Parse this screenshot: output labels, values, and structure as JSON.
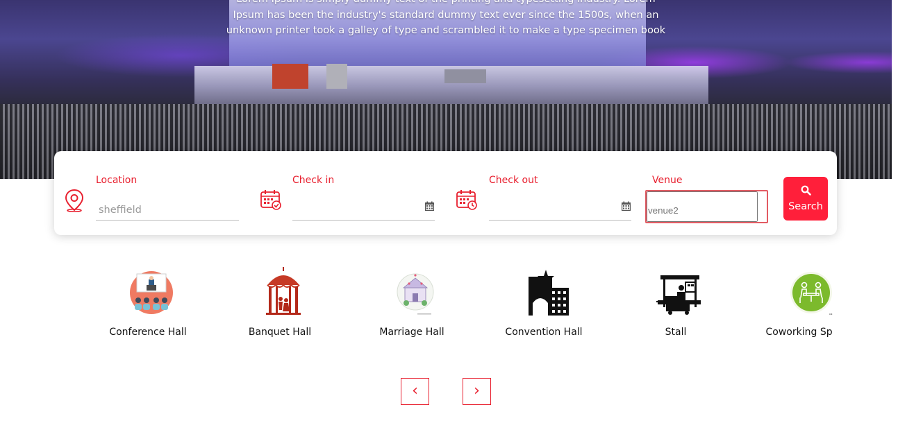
{
  "hero": {
    "text": "Lorem Ipsum is simply dummy text of the printing and typesetting industry. Lorem Ipsum has been the industry's standard dummy text ever since the 1500s, when an unknown printer took a galley of type and scrambled it to make a type specimen book"
  },
  "search": {
    "location_label": "Location",
    "location_placeholder": "sheffield",
    "checkin_label": "Check in",
    "checkout_label": "Check out",
    "venue_label": "Venue",
    "venue_placeholder": "venue2",
    "search_button_label": "Search",
    "accent_color": "#ff1f3a"
  },
  "categories": [
    {
      "label": "Conference Hall",
      "icon": "conference-hall-icon"
    },
    {
      "label": "Banquet Hall",
      "icon": "banquet-hall-icon"
    },
    {
      "label": "Marriage Hall",
      "icon": "marriage-hall-icon"
    },
    {
      "label": "Convention Hall",
      "icon": "convention-hall-icon"
    },
    {
      "label": "Stall",
      "icon": "stall-icon"
    },
    {
      "label": "Coworking Space",
      "icon": "coworking-space-icon"
    }
  ],
  "carousel": {
    "prev_label": "‹",
    "next_label": "›"
  }
}
